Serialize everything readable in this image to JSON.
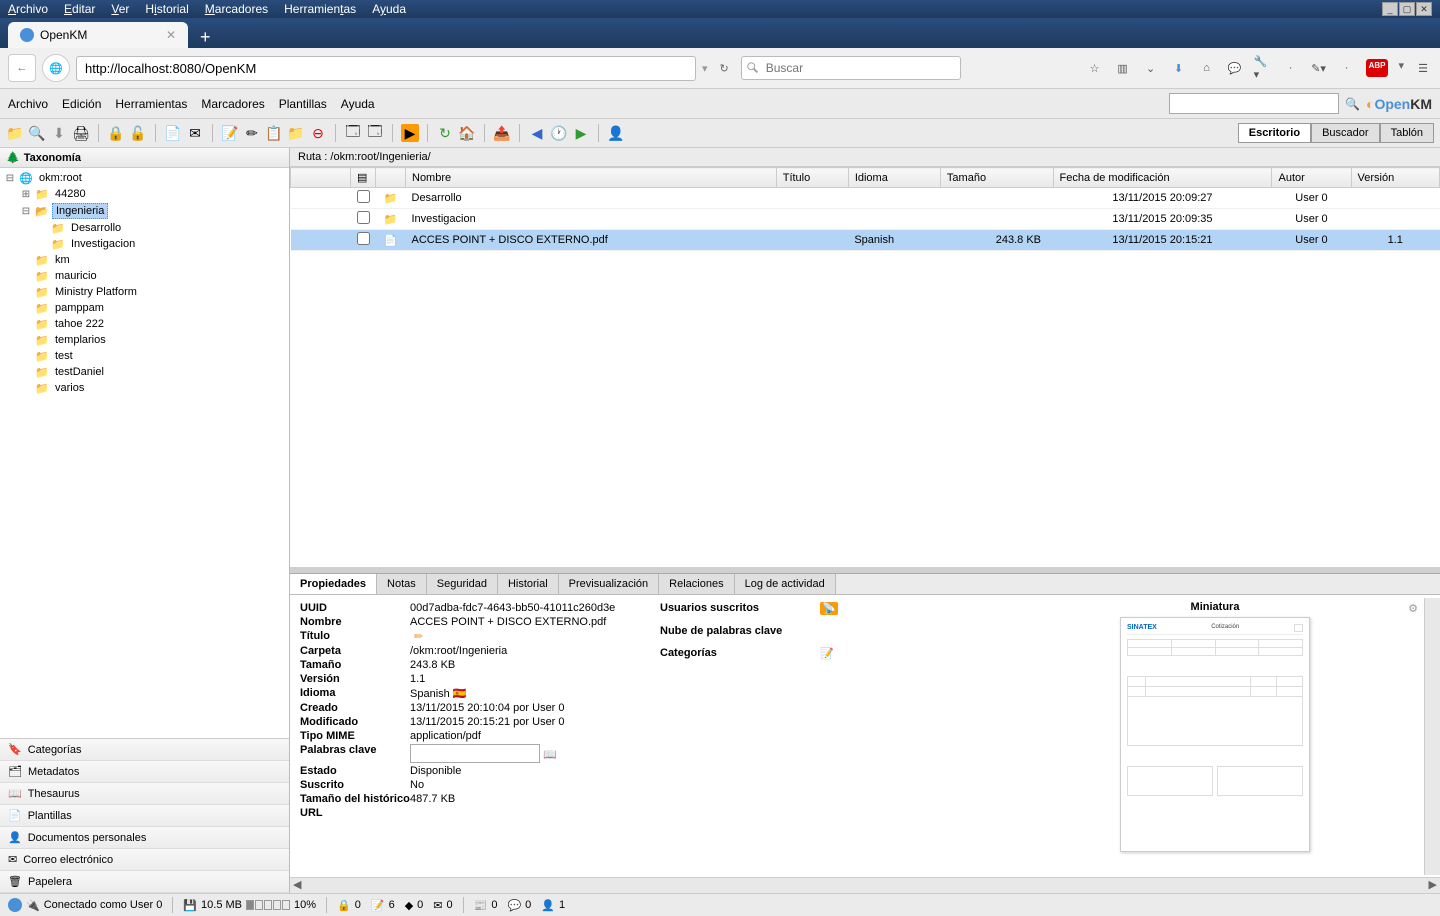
{
  "browser": {
    "menu": [
      "Archivo",
      "Editar",
      "Ver",
      "Historial",
      "Marcadores",
      "Herramientas",
      "Ayuda"
    ],
    "tab_title": "OpenKM",
    "url": "http://localhost:8080/OpenKM",
    "search_placeholder": "Buscar"
  },
  "app": {
    "menu": [
      "Archivo",
      "Edición",
      "Herramientas",
      "Marcadores",
      "Plantillas",
      "Ayuda"
    ],
    "brand_open": "Open",
    "brand_km": "KM",
    "view_tabs": [
      "Escritorio",
      "Buscador",
      "Tablón"
    ],
    "active_view_tab": 0
  },
  "sidebar": {
    "header": "Taxonomía",
    "root": "okm:root",
    "selected": "Ingenieria",
    "root_children": [
      {
        "label": "44280",
        "expanded": false
      },
      {
        "label": "Ingenieria",
        "expanded": true,
        "selected": true,
        "children": [
          "Desarrollo",
          "Investigacion"
        ]
      },
      {
        "label": "km"
      },
      {
        "label": "mauricio"
      },
      {
        "label": "Ministry Platform"
      },
      {
        "label": "pamppam"
      },
      {
        "label": "tahoe 222"
      },
      {
        "label": "templarios"
      },
      {
        "label": "test"
      },
      {
        "label": "testDaniel"
      },
      {
        "label": "varios"
      }
    ],
    "bottom_items": [
      {
        "icon": "🔖",
        "label": "Categorías"
      },
      {
        "icon": "🗂",
        "label": "Metadatos"
      },
      {
        "icon": "📖",
        "label": "Thesaurus"
      },
      {
        "icon": "📄",
        "label": "Plantillas"
      },
      {
        "icon": "👤",
        "label": "Documentos personales"
      },
      {
        "icon": "✉",
        "label": "Correo electrónico"
      },
      {
        "icon": "🗑",
        "label": "Papelera"
      }
    ]
  },
  "breadcrumb": {
    "label": "Ruta :",
    "path": "/okm:root/Ingenieria/"
  },
  "file_table": {
    "columns": [
      "",
      "",
      "",
      "Nombre",
      "Título",
      "Idioma",
      "Tamaño",
      "Fecha de modificación",
      "Autor",
      "Versión"
    ],
    "rows": [
      {
        "type": "folder",
        "name": "Desarrollo",
        "title": "",
        "lang": "",
        "size": "",
        "date": "13/11/2015 20:09:27",
        "author": "User 0",
        "version": ""
      },
      {
        "type": "folder",
        "name": "Investigacion",
        "title": "",
        "lang": "",
        "size": "",
        "date": "13/11/2015 20:09:35",
        "author": "User 0",
        "version": ""
      },
      {
        "type": "pdf",
        "name": "ACCES POINT + DISCO EXTERNO.pdf",
        "title": "",
        "lang": "Spanish",
        "size": "243.8 KB",
        "date": "13/11/2015 20:15:21",
        "author": "User 0",
        "version": "1.1",
        "selected": true
      }
    ]
  },
  "props": {
    "tabs": [
      "Propiedades",
      "Notas",
      "Seguridad",
      "Historial",
      "Previsualización",
      "Relaciones",
      "Log de actividad"
    ],
    "active_tab": 0,
    "fields": {
      "uuid_label": "UUID",
      "uuid": "00d7adba-fdc7-4643-bb50-41011c260d3e",
      "nombre_label": "Nombre",
      "nombre": "ACCES POINT + DISCO EXTERNO.pdf",
      "titulo_label": "Título",
      "titulo": "",
      "carpeta_label": "Carpeta",
      "carpeta": "/okm:root/Ingenieria",
      "tamano_label": "Tamaño",
      "tamano": "243.8 KB",
      "version_label": "Versión",
      "version": "1.1",
      "idioma_label": "Idioma",
      "idioma": "Spanish",
      "creado_label": "Creado",
      "creado": "13/11/2015 20:10:04 por User 0",
      "modificado_label": "Modificado",
      "modificado": "13/11/2015 20:15:21 por User 0",
      "mime_label": "Tipo MIME",
      "mime": "application/pdf",
      "palabras_label": "Palabras clave",
      "estado_label": "Estado",
      "estado": "Disponible",
      "suscrito_label": "Suscrito",
      "suscrito": "No",
      "historico_label": "Tamaño del histórico",
      "historico": "487.7 KB",
      "url_label": "URL"
    },
    "mid": {
      "usuarios": "Usuarios suscritos",
      "nube": "Nube de palabras clave",
      "categorias": "Categorías"
    },
    "thumb_title": "Miniatura",
    "thumb_company": "SINATEX",
    "thumb_doc_title": "Cotización"
  },
  "statusbar": {
    "connected": "Conectado como User 0",
    "memory": "10.5 MB",
    "memory_pct": "10%",
    "locks": "0",
    "docs": "6",
    "folders": "0",
    "mail": "0",
    "news": "0",
    "chat": "0",
    "users": "1"
  }
}
